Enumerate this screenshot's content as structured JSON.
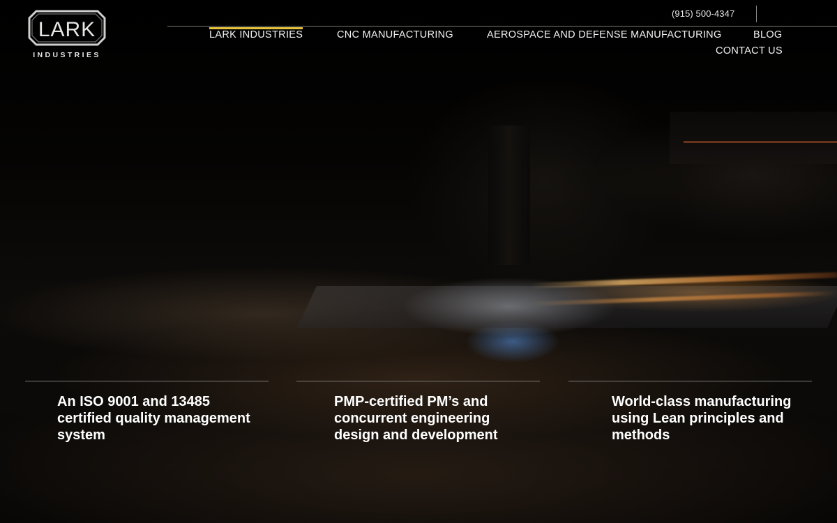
{
  "brand": {
    "logo_word": "LARK",
    "logo_subword": "INDUSTRIES"
  },
  "header": {
    "phone": "(915) 500-4347"
  },
  "nav": {
    "items": [
      {
        "label": "LARK INDUSTRIES",
        "active": true
      },
      {
        "label": "CNC MANUFACTURING",
        "active": false
      },
      {
        "label": "AEROSPACE AND DEFENSE MANUFACTURING",
        "active": false
      },
      {
        "label": "BLOG",
        "active": false
      },
      {
        "label": "CONTACT US",
        "active": false
      }
    ],
    "active_color": "#e8c33c"
  },
  "features": [
    {
      "text": "An ISO 9001 and 13485 certified quality management system"
    },
    {
      "text": "PMP-certified PM’s and concurrent engineering design and development"
    },
    {
      "text": "World-class manufacturing using Lean principles and methods"
    }
  ],
  "hero": {
    "image_subject": "plasma-cutter-sparks-workshop"
  }
}
